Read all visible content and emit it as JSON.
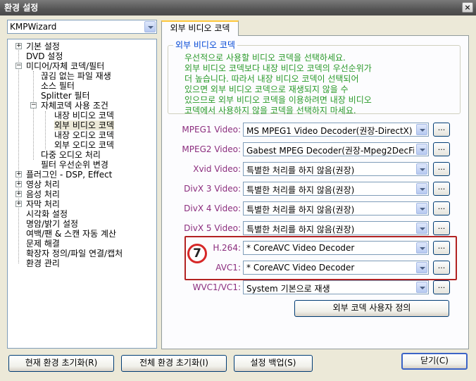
{
  "window": {
    "title": "환경 설정",
    "close_glyph": "×"
  },
  "profile": {
    "selected": "KMPWizard"
  },
  "tree": {
    "items": [
      {
        "label": "기본 설정",
        "expander": "+"
      },
      {
        "label": "DVD 설정"
      },
      {
        "label": "미디어/자체 코덱/필터",
        "expander": "−"
      },
      {
        "label": "끊김 없는 파일 재생"
      },
      {
        "label": "소스 필터"
      },
      {
        "label": "Splitter 필터"
      },
      {
        "label": "자체코덱 사용 조건",
        "expander": "−"
      },
      {
        "label": "내장 비디오 코덱"
      },
      {
        "label": "외부 비디오 코덱"
      },
      {
        "label": "내장 오디오 코덱"
      },
      {
        "label": "외부 오디오 코덱"
      },
      {
        "label": "다중 오디오 처리"
      },
      {
        "label": "필터 우선순위 변경"
      },
      {
        "label": "플러그인 - DSP, Effect",
        "expander": "+"
      },
      {
        "label": "영상 처리",
        "expander": "+"
      },
      {
        "label": "음성 처리",
        "expander": "+"
      },
      {
        "label": "자막 처리",
        "expander": "+"
      },
      {
        "label": "시각화 설정"
      },
      {
        "label": "명암/밝기 설정"
      },
      {
        "label": "여백/팬 & 스캔 자동 계산"
      },
      {
        "label": "문제 해결"
      },
      {
        "label": "확장자 정의/파일 연결/캡처"
      },
      {
        "label": "환경 관리"
      }
    ]
  },
  "tab": {
    "label": "외부 비디오 코덱"
  },
  "group": {
    "title": "외부 비디오 코덱",
    "description": [
      "우선적으로 사용할 비디오 코덱을 선택하세요.",
      "외부 비디오 코덱보다 내장 비디오 코덱의 우선순위가",
      "더 높습니다. 따라서 내장 비디오 코덱이 선택되어",
      "있으면 외부 비디오 코덱으로 재생되지 않을 수",
      "있으므로 외부 비디오 코덱을 이용하려면 내장 비디오",
      "코덱에서 사용하지 않을 코덱을 선택하지 마세요."
    ]
  },
  "codecs": [
    {
      "label": "MPEG1 Video:",
      "value": "MS MPEG1 Video Decoder(권장-DirectX)"
    },
    {
      "label": "MPEG2 Video:",
      "value": "Gabest MPEG Decoder(권장-Mpeg2DecFil"
    },
    {
      "label": "Xvid Video:",
      "value": "특별한 처리를 하지 않음(권장)"
    },
    {
      "label": "DivX 3 Video:",
      "value": "특별한 처리를 하지 않음(권장)"
    },
    {
      "label": "DivX 4 Video:",
      "value": "특별한 처리를 하지 않음(권장)"
    },
    {
      "label": "DivX 5 Video:",
      "value": "특별한 처리를 하지 않음(권장)"
    },
    {
      "label": "H.264:",
      "value": "* CoreAVC Video Decoder"
    },
    {
      "label": "AVC1:",
      "value": "* CoreAVC Video Decoder"
    },
    {
      "label": "WVC1/VC1:",
      "value": "System 기본으로 재생"
    }
  ],
  "browse_label": "...",
  "step_badge": "7",
  "custom_codec_button": "외부 코덱 사용자 정의",
  "footer": {
    "reset_current": "현재 환경 초기화(R)",
    "reset_all": "전체 환경 초기화(I)",
    "backup": "설정 백업(S)",
    "close": "닫기(C)"
  },
  "colors": {
    "label_color": "#8b2d7e",
    "description_color": "#2a9a2a",
    "group_title_color": "#0046d5",
    "highlight_color": "#b22222"
  }
}
